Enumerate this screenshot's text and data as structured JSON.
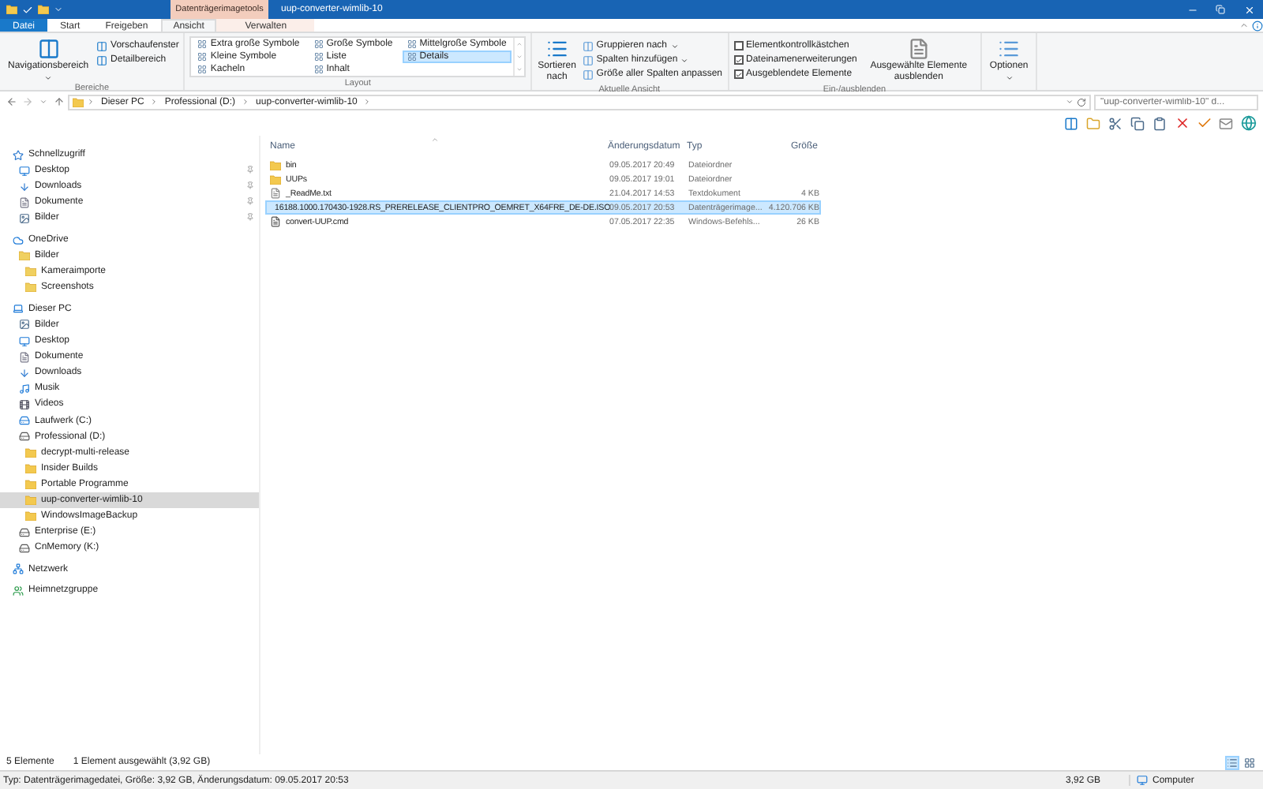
{
  "title_bar": {
    "context_tab": "Datenträgerimagetools",
    "title": "uup-converter-wimlib-10"
  },
  "ribbon_tabs": [
    {
      "label": "Datei",
      "kind": "file",
      "selected": false
    },
    {
      "label": "Start",
      "kind": "tab",
      "selected": false
    },
    {
      "label": "Freigeben",
      "kind": "tab",
      "selected": false
    },
    {
      "label": "Ansicht",
      "kind": "tab",
      "selected": true
    },
    {
      "label": "Verwalten",
      "kind": "context",
      "selected": false
    }
  ],
  "panes": {
    "label": "Bereiche",
    "main": "Navigationsbereich",
    "buttons": [
      "Vorschaufenster",
      "Detailbereich"
    ]
  },
  "layout": {
    "label": "Layout",
    "options": [
      {
        "label": "Extra große Symbole",
        "selected": false
      },
      {
        "label": "Kleine Symbole",
        "selected": false
      },
      {
        "label": "Kacheln",
        "selected": false
      },
      {
        "label": "Große Symbole",
        "selected": false
      },
      {
        "label": "Liste",
        "selected": false
      },
      {
        "label": "Inhalt",
        "selected": false
      },
      {
        "label": "Mittelgroße Symbole",
        "selected": false
      },
      {
        "label": "Details",
        "selected": true
      }
    ]
  },
  "current_view": {
    "label": "Aktuelle Ansicht",
    "sort": "Sortieren nach",
    "buttons": [
      {
        "label": "Gruppieren nach",
        "dropdown": true
      },
      {
        "label": "Spalten hinzufügen",
        "dropdown": true
      },
      {
        "label": "Größe aller Spalten anpassen",
        "dropdown": false
      }
    ]
  },
  "show_hide": {
    "label": "Ein-/ausblenden",
    "checks": [
      {
        "label": "Elementkontrollkästchen",
        "checked": false
      },
      {
        "label": "Dateinamenerweiterungen",
        "checked": true
      },
      {
        "label": "Ausgeblendete Elemente",
        "checked": true
      }
    ],
    "hide": "Ausgewählte Elemente ausblenden"
  },
  "options": {
    "label": "Optionen"
  },
  "address": {
    "crumbs": [
      "Dieser PC",
      "Professional (D:)",
      "uup-converter-wimlib-10"
    ],
    "search_placeholder": "\"uup-converter-wimlib-10\" d..."
  },
  "sidebar": [
    {
      "label": "Schnellzugriff",
      "kind": "star",
      "selected": false,
      "children": [
        {
          "label": "Desktop",
          "kind": "desktop",
          "selected": false,
          "pinned": true
        },
        {
          "label": "Downloads",
          "kind": "download",
          "selected": false,
          "pinned": true
        },
        {
          "label": "Dokumente",
          "kind": "doc",
          "selected": false,
          "pinned": true
        },
        {
          "label": "Bilder",
          "kind": "pictures",
          "selected": false,
          "pinned": true
        }
      ]
    },
    {
      "label": "OneDrive",
      "kind": "cloud",
      "selected": false,
      "children": [
        {
          "label": "Bilder",
          "kind": "cloudfolder",
          "selected": false,
          "children": [
            {
              "label": "Kameraimporte",
              "kind": "cloudfolder",
              "selected": false
            },
            {
              "label": "Screenshots",
              "kind": "cloudfolder",
              "selected": false
            }
          ]
        }
      ]
    },
    {
      "label": "Dieser PC",
      "kind": "pc",
      "selected": false,
      "children": [
        {
          "label": "Bilder",
          "kind": "pictures",
          "selected": false
        },
        {
          "label": "Desktop",
          "kind": "desktop",
          "selected": false
        },
        {
          "label": "Dokumente",
          "kind": "doc",
          "selected": false
        },
        {
          "label": "Downloads",
          "kind": "download",
          "selected": false
        },
        {
          "label": "Musik",
          "kind": "music",
          "selected": false
        },
        {
          "label": "Videos",
          "kind": "video",
          "selected": false
        },
        {
          "label": "Laufwerk (C:)",
          "kind": "system",
          "selected": false
        },
        {
          "label": "Professional (D:)",
          "kind": "drive",
          "selected": false,
          "children": [
            {
              "label": "decrypt-multi-release",
              "kind": "folder",
              "selected": false
            },
            {
              "label": "Insider Builds",
              "kind": "folder",
              "selected": false
            },
            {
              "label": "Portable Programme",
              "kind": "folder",
              "selected": false
            },
            {
              "label": "uup-converter-wimlib-10",
              "kind": "folder",
              "selected": true
            },
            {
              "label": "WindowsImageBackup",
              "kind": "folder",
              "selected": false
            }
          ]
        },
        {
          "label": "Enterprise (E:)",
          "kind": "drive",
          "selected": false
        },
        {
          "label": "CnMemory (K:)",
          "kind": "drive",
          "selected": false
        }
      ]
    },
    {
      "label": "Netzwerk",
      "kind": "network",
      "selected": false
    },
    {
      "label": "Heimnetzgruppe",
      "kind": "home",
      "selected": false
    }
  ],
  "columns": [
    "Name",
    "Änderungsdatum",
    "Typ",
    "Größe"
  ],
  "files": [
    {
      "name": "bin",
      "date": "09.05.2017 20:49",
      "type": "Dateiordner",
      "kind": "folder",
      "selected": false
    },
    {
      "name": "UUPs",
      "date": "09.05.2017 19:01",
      "type": "Dateiordner",
      "kind": "folder",
      "selected": false
    },
    {
      "name": "_ReadMe.txt",
      "date": "21.04.2017 14:53",
      "type": "Textdokument",
      "size": "4 KB",
      "kind": "text",
      "selected": false
    },
    {
      "name": "16188.1000.170430-1928.RS_PRERELEASE_CLIENTPRO_OEMRET_X64FRE_DE-DE.ISO",
      "date": "09.05.2017 20:53",
      "type": "Datenträgerimage...",
      "size": "4.120.706 KB",
      "kind": "image",
      "selected": true
    },
    {
      "name": "convert-UUP.cmd",
      "date": "07.05.2017 22:35",
      "type": "Windows-Befehls...",
      "size": "26 KB",
      "kind": "script",
      "selected": false
    }
  ],
  "status": {
    "count": "5 Elemente",
    "selection": "1 Element ausgewählt (3,92 GB)"
  },
  "details_bar": {
    "info": "Typ: Datenträgerimagedatei, Größe: 3,92 GB, Änderungsdatum: 09.05.2017 20:53",
    "size": "3,92 GB",
    "location": "Computer"
  }
}
